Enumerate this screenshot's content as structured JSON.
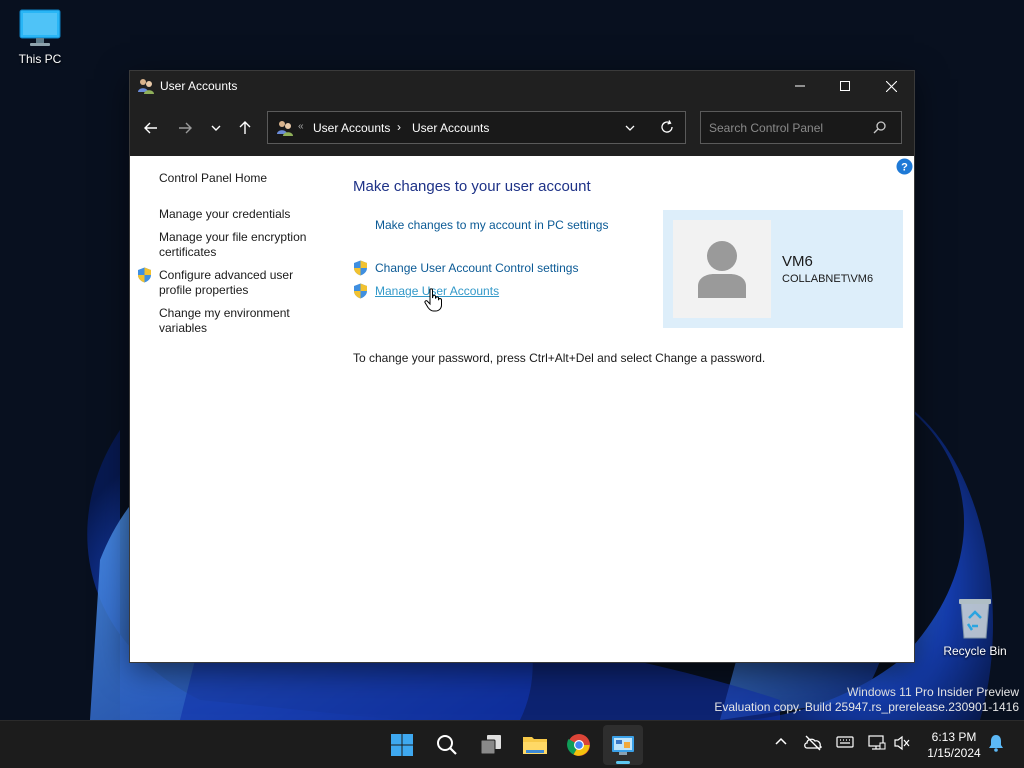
{
  "desktop": {
    "this_pc_label": "This PC",
    "recycle_bin_label": "Recycle Bin",
    "watermark_line1": "Windows 11 Pro Insider Preview",
    "watermark_line2": "Evaluation copy. Build 25947.rs_prerelease.230901-1416"
  },
  "window": {
    "title": "User Accounts",
    "icons": {
      "app": "users-icon",
      "minimize": "minimize-icon",
      "maximize": "maximize-icon",
      "close": "close-icon"
    }
  },
  "nav": {
    "breadcrumb_lead": "«",
    "breadcrumb": [
      "User Accounts",
      "User Accounts"
    ],
    "breadcrumb_separator": "›",
    "search_placeholder": "Search Control Panel",
    "icons": [
      "back-icon",
      "forward-icon",
      "chevron-down-icon",
      "up-arrow-icon",
      "refresh-icon",
      "search-icon"
    ]
  },
  "sidebar": {
    "items": [
      "Control Panel Home",
      "Manage your credentials",
      "Manage your file encryption certificates",
      "Configure advanced user profile properties",
      "Change my environment variables"
    ]
  },
  "main": {
    "heading": "Make changes to your user account",
    "links": [
      "Make changes to my account in PC settings",
      "Change User Account Control settings",
      "Manage User Accounts"
    ],
    "info": "To change your password, press Ctrl+Alt+Del and select Change a password."
  },
  "account": {
    "name": "VM6",
    "domain": "COLLABNET\\VM6"
  },
  "taskbar": {
    "apps": [
      "start-icon",
      "search-icon",
      "task-view-icon",
      "file-explorer-icon",
      "chrome-icon",
      "control-panel-icon"
    ],
    "time": "6:13 PM",
    "date": "1/15/2024"
  },
  "colors": {
    "heading": "#1e3287",
    "link": "#0b5a95",
    "link_hover": "#3399c9",
    "card": "#ddeefa",
    "titlebar": "#202020"
  }
}
